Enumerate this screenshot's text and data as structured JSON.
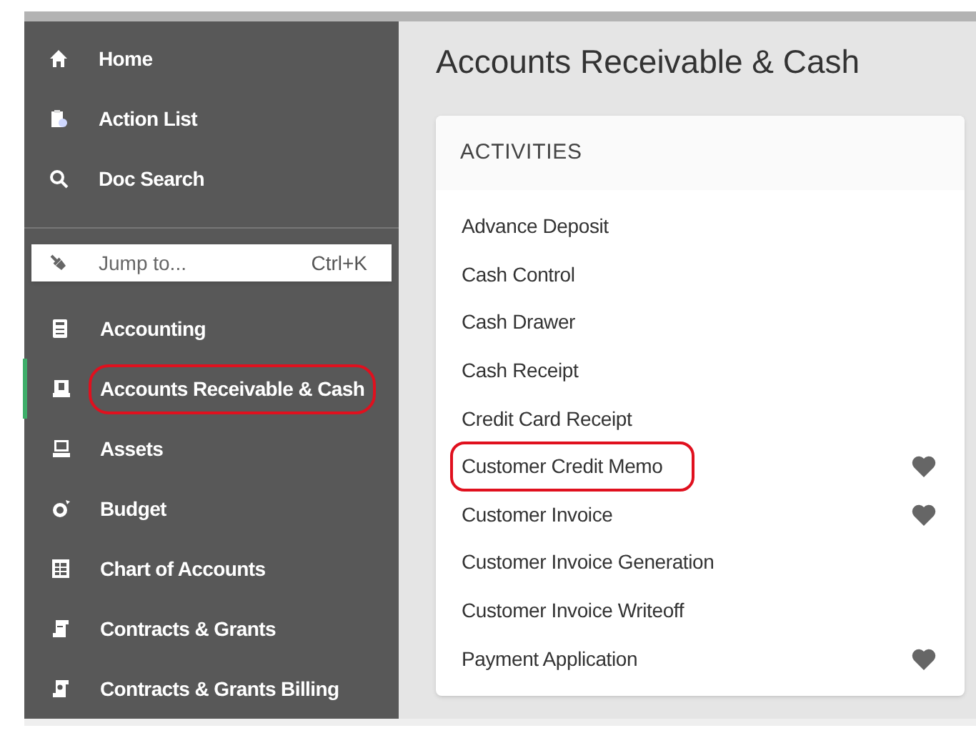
{
  "sidebar": {
    "top_items": [
      {
        "label": "Home"
      },
      {
        "label": "Action List"
      },
      {
        "label": "Doc Search"
      }
    ],
    "jump_field": {
      "placeholder": "Jump to...",
      "shortcut": "Ctrl+K"
    },
    "items": [
      {
        "label": "Accounting",
        "selected": false,
        "circled": false
      },
      {
        "label": "Accounts Receivable & Cash",
        "selected": true,
        "circled": true
      },
      {
        "label": "Assets",
        "selected": false,
        "circled": false
      },
      {
        "label": "Budget",
        "selected": false,
        "circled": false
      },
      {
        "label": "Chart of Accounts",
        "selected": false,
        "circled": false
      },
      {
        "label": "Contracts & Grants",
        "selected": false,
        "circled": false
      },
      {
        "label": "Contracts & Grants Billing",
        "selected": false,
        "circled": false
      }
    ]
  },
  "main": {
    "title": "Accounts Receivable & Cash",
    "card": {
      "heading": "ACTIVITIES",
      "items": [
        {
          "label": "Advance Deposit",
          "favorite": false,
          "circled": false
        },
        {
          "label": "Cash Control",
          "favorite": false,
          "circled": false
        },
        {
          "label": "Cash Drawer",
          "favorite": false,
          "circled": false
        },
        {
          "label": "Cash Receipt",
          "favorite": false,
          "circled": false
        },
        {
          "label": "Credit Card Receipt",
          "favorite": false,
          "circled": false
        },
        {
          "label": "Customer Credit Memo",
          "favorite": true,
          "circled": true
        },
        {
          "label": "Customer Invoice",
          "favorite": true,
          "circled": false
        },
        {
          "label": "Customer Invoice Generation",
          "favorite": false,
          "circled": false
        },
        {
          "label": "Customer Invoice Writeoff",
          "favorite": false,
          "circled": false
        },
        {
          "label": "Payment Application",
          "favorite": true,
          "circled": false
        }
      ]
    }
  }
}
